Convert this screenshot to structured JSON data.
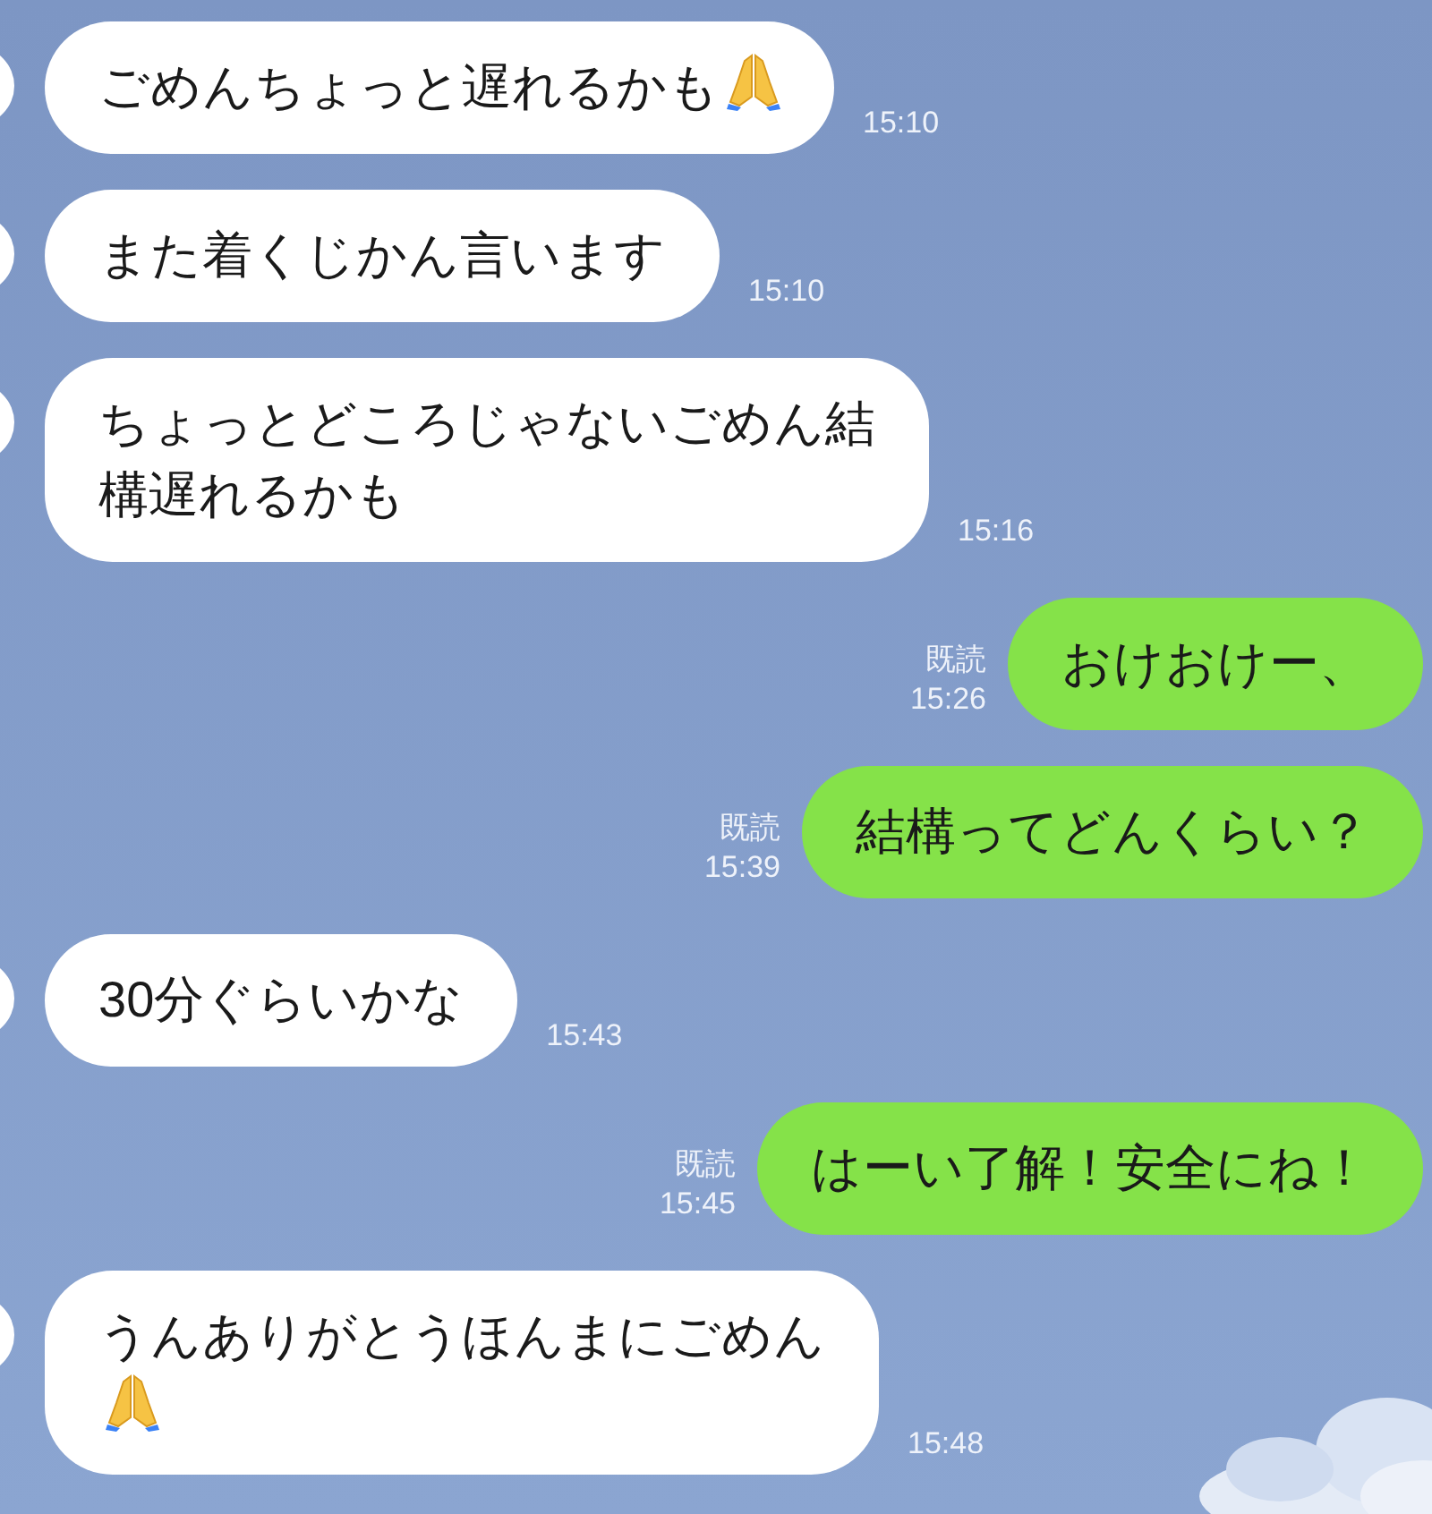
{
  "messages": [
    {
      "kind": "incoming",
      "lines": [
        [
          {
            "kind": "text",
            "text": "ごめんちょっと遅れるかも"
          },
          {
            "kind": "emoji"
          }
        ]
      ],
      "time": "15:10"
    },
    {
      "kind": "incoming",
      "lines": [
        [
          {
            "kind": "text",
            "text": "また着くじかん言います"
          }
        ]
      ],
      "time": "15:10"
    },
    {
      "kind": "incoming",
      "lines": [
        [
          {
            "kind": "text",
            "text": "ちょっとどころじゃないごめん結"
          }
        ],
        [
          {
            "kind": "text",
            "text": "構遅れるかも"
          }
        ]
      ],
      "time": "15:16"
    },
    {
      "kind": "outgoing",
      "lines": [
        [
          {
            "kind": "text",
            "text": "おけおけー、"
          }
        ]
      ],
      "read": "既読",
      "time": "15:26"
    },
    {
      "kind": "outgoing",
      "lines": [
        [
          {
            "kind": "text",
            "text": "結構ってどんくらい？"
          }
        ]
      ],
      "read": "既読",
      "time": "15:39"
    },
    {
      "kind": "incoming",
      "lines": [
        [
          {
            "kind": "text",
            "text": "30分ぐらいかな"
          }
        ]
      ],
      "time": "15:43"
    },
    {
      "kind": "outgoing",
      "lines": [
        [
          {
            "kind": "text",
            "text": "はーい了解！安全にね！"
          }
        ]
      ],
      "read": "既読",
      "time": "15:45"
    },
    {
      "kind": "incoming",
      "lines": [
        [
          {
            "kind": "text",
            "text": "うんありがとうほんまにごめん"
          }
        ],
        [
          {
            "kind": "emoji"
          }
        ]
      ],
      "time": "15:48"
    }
  ]
}
